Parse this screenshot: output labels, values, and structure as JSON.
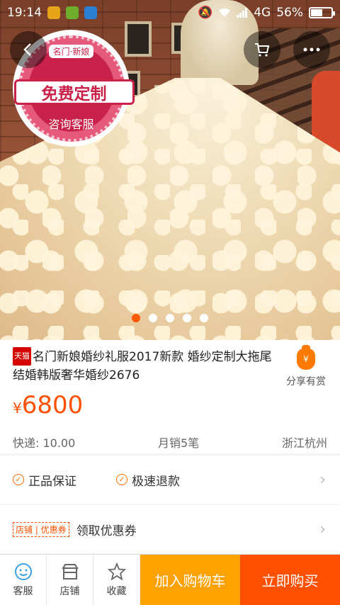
{
  "status_bar": {
    "time": "19:14",
    "network": "4G",
    "battery": "56%",
    "battery_level": 0.56
  },
  "hero": {
    "seal_brand": "名门·新娘",
    "seal_main": "免费定制",
    "seal_sub": "咨询客服",
    "slides_total": 5,
    "active_slide": 1
  },
  "product": {
    "tmall_badge": "天猫",
    "title": "名门新娘婚纱礼服2017新款 婚纱定制大拖尾结婚韩版奢华婚纱2676",
    "share_label": "分享有赏",
    "share_icon_text": "¥",
    "price_currency": "¥",
    "price_value": "6800",
    "shipping": "快递: 10.00",
    "monthly_sales": "月销5笔",
    "location": "浙江杭州"
  },
  "guarantees": {
    "item1": "正品保证",
    "item2": "极速退款"
  },
  "coupon": {
    "tag": "店铺 | 优惠券",
    "label": "领取优惠券"
  },
  "bottom_bar": {
    "service": "客服",
    "shop": "店铺",
    "favorite": "收藏",
    "add_to_cart": "加入购物车",
    "buy_now": "立即购买"
  },
  "colors": {
    "accent": "#ff5000",
    "cart_button": "#ffa200",
    "seal": "#c8224a"
  }
}
